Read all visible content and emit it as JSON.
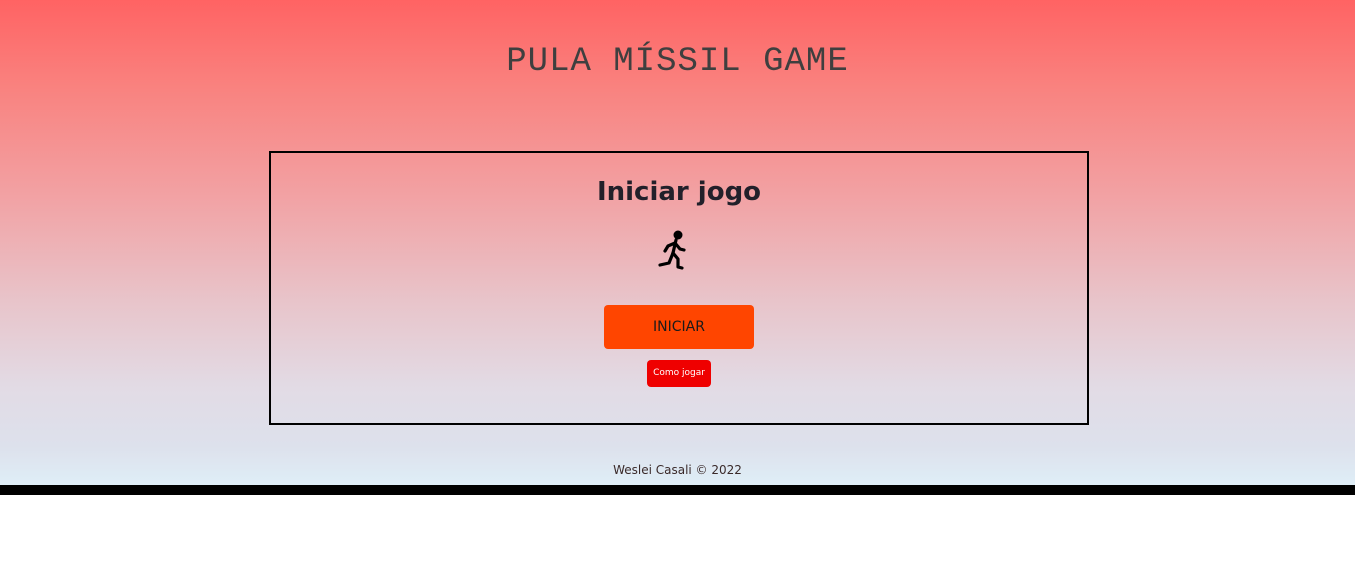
{
  "header": {
    "title": "PULA MÍSSIL GAME"
  },
  "start_panel": {
    "heading": "Iniciar jogo",
    "icon": "running-person-icon",
    "start_button_label": "INICIAR",
    "help_button_label": "Como jogar"
  },
  "footer": {
    "credit": "Weslei Casali © 2022"
  },
  "colors": {
    "start_button": "#ff4500",
    "help_button": "#ef0000",
    "gradient_top": "#ff6363",
    "gradient_bottom": "#dfeef7"
  }
}
